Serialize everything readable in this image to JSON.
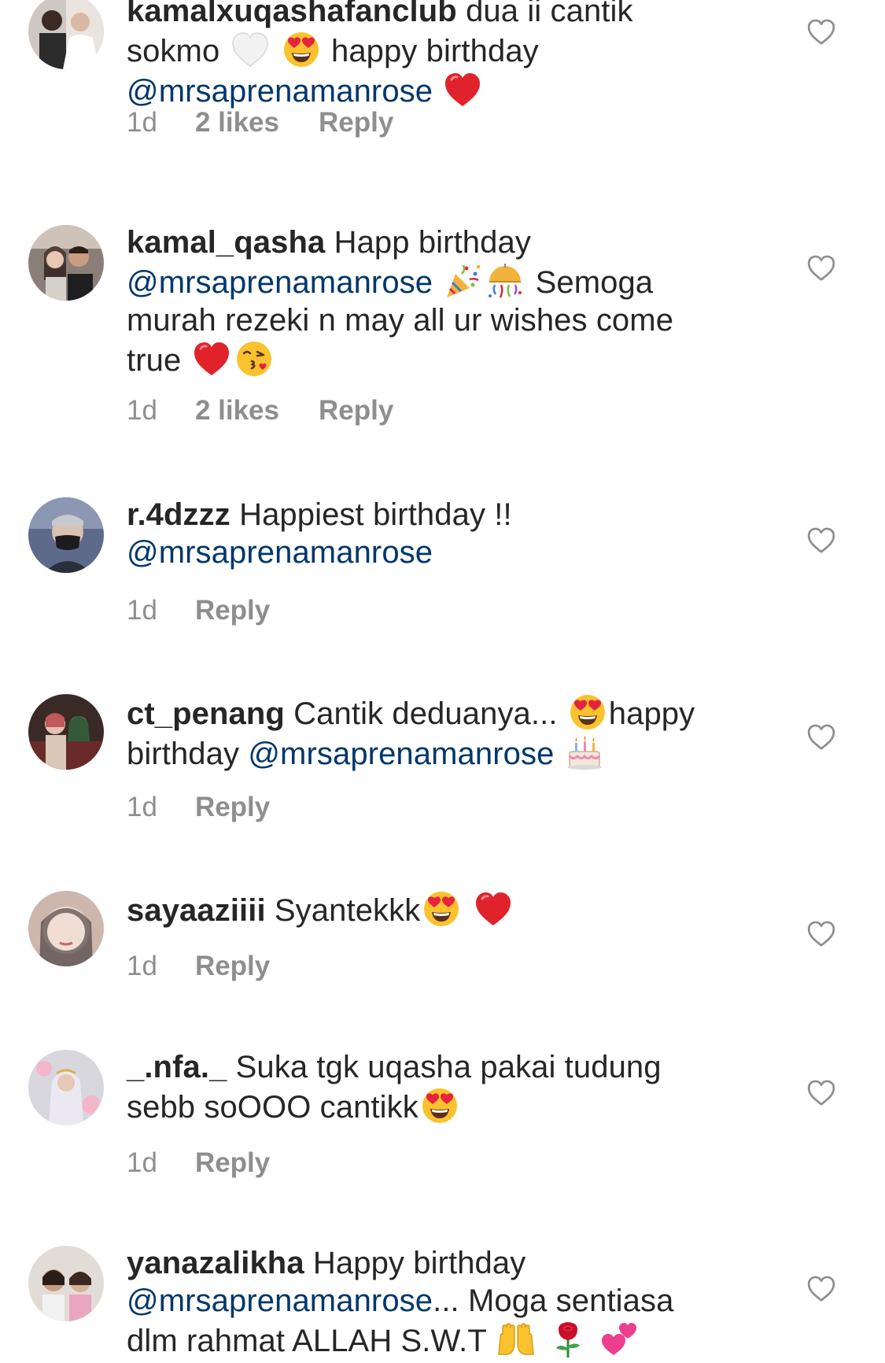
{
  "comments": [
    {
      "username": "kamalxuqashafanclub",
      "parts": [
        "dua ii cantik sokmo",
        "happy birthday"
      ],
      "mention": "@mrsaprenamanrose",
      "time": "1d",
      "likes": "2 likes",
      "reply": "Reply",
      "emojis": [
        "white-heart",
        "heart-eyes",
        "red-heart"
      ]
    },
    {
      "username": "kamal_qasha",
      "parts": [
        "Happ birthday",
        "Semoga murah rezeki n may all ur wishes come true"
      ],
      "mention": "@mrsaprenamanrose",
      "time": "1d",
      "likes": "2 likes",
      "reply": "Reply",
      "emojis": [
        "party-popper",
        "confetti-ball",
        "red-heart",
        "kissing-face"
      ]
    },
    {
      "username": "r.4dzzz",
      "parts": [
        "Happiest birthday !!"
      ],
      "mention": "@mrsaprenamanrose",
      "time": "1d",
      "reply": "Reply"
    },
    {
      "username": "ct_penang",
      "parts": [
        "Cantik deduanya...",
        "happy birthday"
      ],
      "mention": "@mrsaprenamanrose",
      "time": "1d",
      "reply": "Reply",
      "emojis": [
        "heart-eyes",
        "birthday-cake"
      ]
    },
    {
      "username": "sayaaziiii",
      "parts": [
        "Syantekkk"
      ],
      "time": "1d",
      "reply": "Reply",
      "emojis": [
        "heart-eyes",
        "red-heart"
      ]
    },
    {
      "username": "_.nfa._",
      "parts": [
        "Suka tgk uqasha pakai tudung sebb soOOO cantikk"
      ],
      "time": "1d",
      "reply": "Reply",
      "emojis": [
        "heart-eyes"
      ]
    },
    {
      "username": "yanazalikha",
      "parts": [
        "Happy birthday",
        "... Moga sentiasa dlm rahmat ALLAH S.W.T"
      ],
      "mention": "@mrsaprenamanrose",
      "emojis": [
        "raising-hands",
        "rose",
        "two-hearts"
      ]
    }
  ],
  "colors": {
    "username": "#262626",
    "text": "#262626",
    "mention": "#00376b",
    "meta": "#8e8e8e",
    "heart_outline": "#8e8e8e",
    "background": "#ffffff"
  }
}
